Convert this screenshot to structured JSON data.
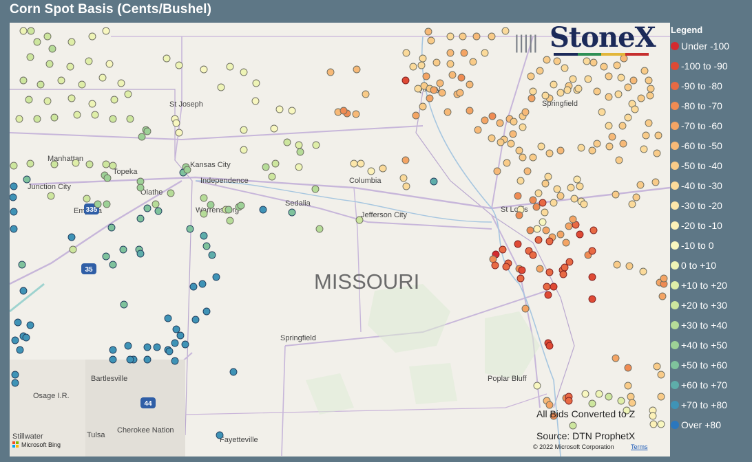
{
  "title": "Corn Spot Basis (Cents/Bushel)",
  "legend": {
    "title": "Legend",
    "items": [
      {
        "label": "Under -100",
        "color": "#d42a2f"
      },
      {
        "label": "-100 to -90",
        "color": "#df4a35"
      },
      {
        "label": "-90 to -80",
        "color": "#e86a44"
      },
      {
        "label": "-80 to -70",
        "color": "#ef8b53"
      },
      {
        "label": "-70 to -60",
        "color": "#f4a464"
      },
      {
        "label": "-60 to -50",
        "color": "#f7b977"
      },
      {
        "label": "-50 to -40",
        "color": "#f9cb88"
      },
      {
        "label": "-40 to -30",
        "color": "#fbda9a"
      },
      {
        "label": "-30 to -20",
        "color": "#fce6aa"
      },
      {
        "label": "-20 to -10",
        "color": "#fcf1b8"
      },
      {
        "label": "-10 to 0",
        "color": "#f8f7c0"
      },
      {
        "label": "0 to +10",
        "color": "#eef4b6"
      },
      {
        "label": "+10 to +20",
        "color": "#dfeea8"
      },
      {
        "label": "+20 to +30",
        "color": "#cde69e"
      },
      {
        "label": "+30 to +40",
        "color": "#b6dc98"
      },
      {
        "label": "+40 to +50",
        "color": "#9dd196"
      },
      {
        "label": "+50 to +60",
        "color": "#7fc29c"
      },
      {
        "label": "+60 to +70",
        "color": "#5eadaa"
      },
      {
        "label": "+70 to +80",
        "color": "#3f93b6"
      },
      {
        "label": "Over +80",
        "color": "#2b77bd"
      }
    ]
  },
  "logo": {
    "text": "StoneX",
    "mark": "|||||"
  },
  "map": {
    "state_label": "MISSOURI",
    "cities": [
      "St Joseph",
      "Kansas City",
      "Independence",
      "Manhattan",
      "Topeka",
      "Junction City",
      "Olathe",
      "Emporia",
      "Warrensburg",
      "Sedalia",
      "Columbia",
      "Jefferson City",
      "Quincy",
      "Springfield",
      "St Louis",
      "Springfield",
      "Bartlesville",
      "Osage I.R.",
      "Tulsa",
      "Cherokee Nation",
      "Stillwater",
      "Fayetteville",
      "Poplar Bluff"
    ],
    "highways": [
      "35",
      "335",
      "44"
    ]
  },
  "notes": {
    "bids": "All Bids Converted to Z",
    "source": "Source: DTN ProphetX"
  },
  "footer": {
    "bing": "Microsoft Bing",
    "copyright": "© 2022 Microsoft Corporation",
    "terms": "Terms"
  }
}
